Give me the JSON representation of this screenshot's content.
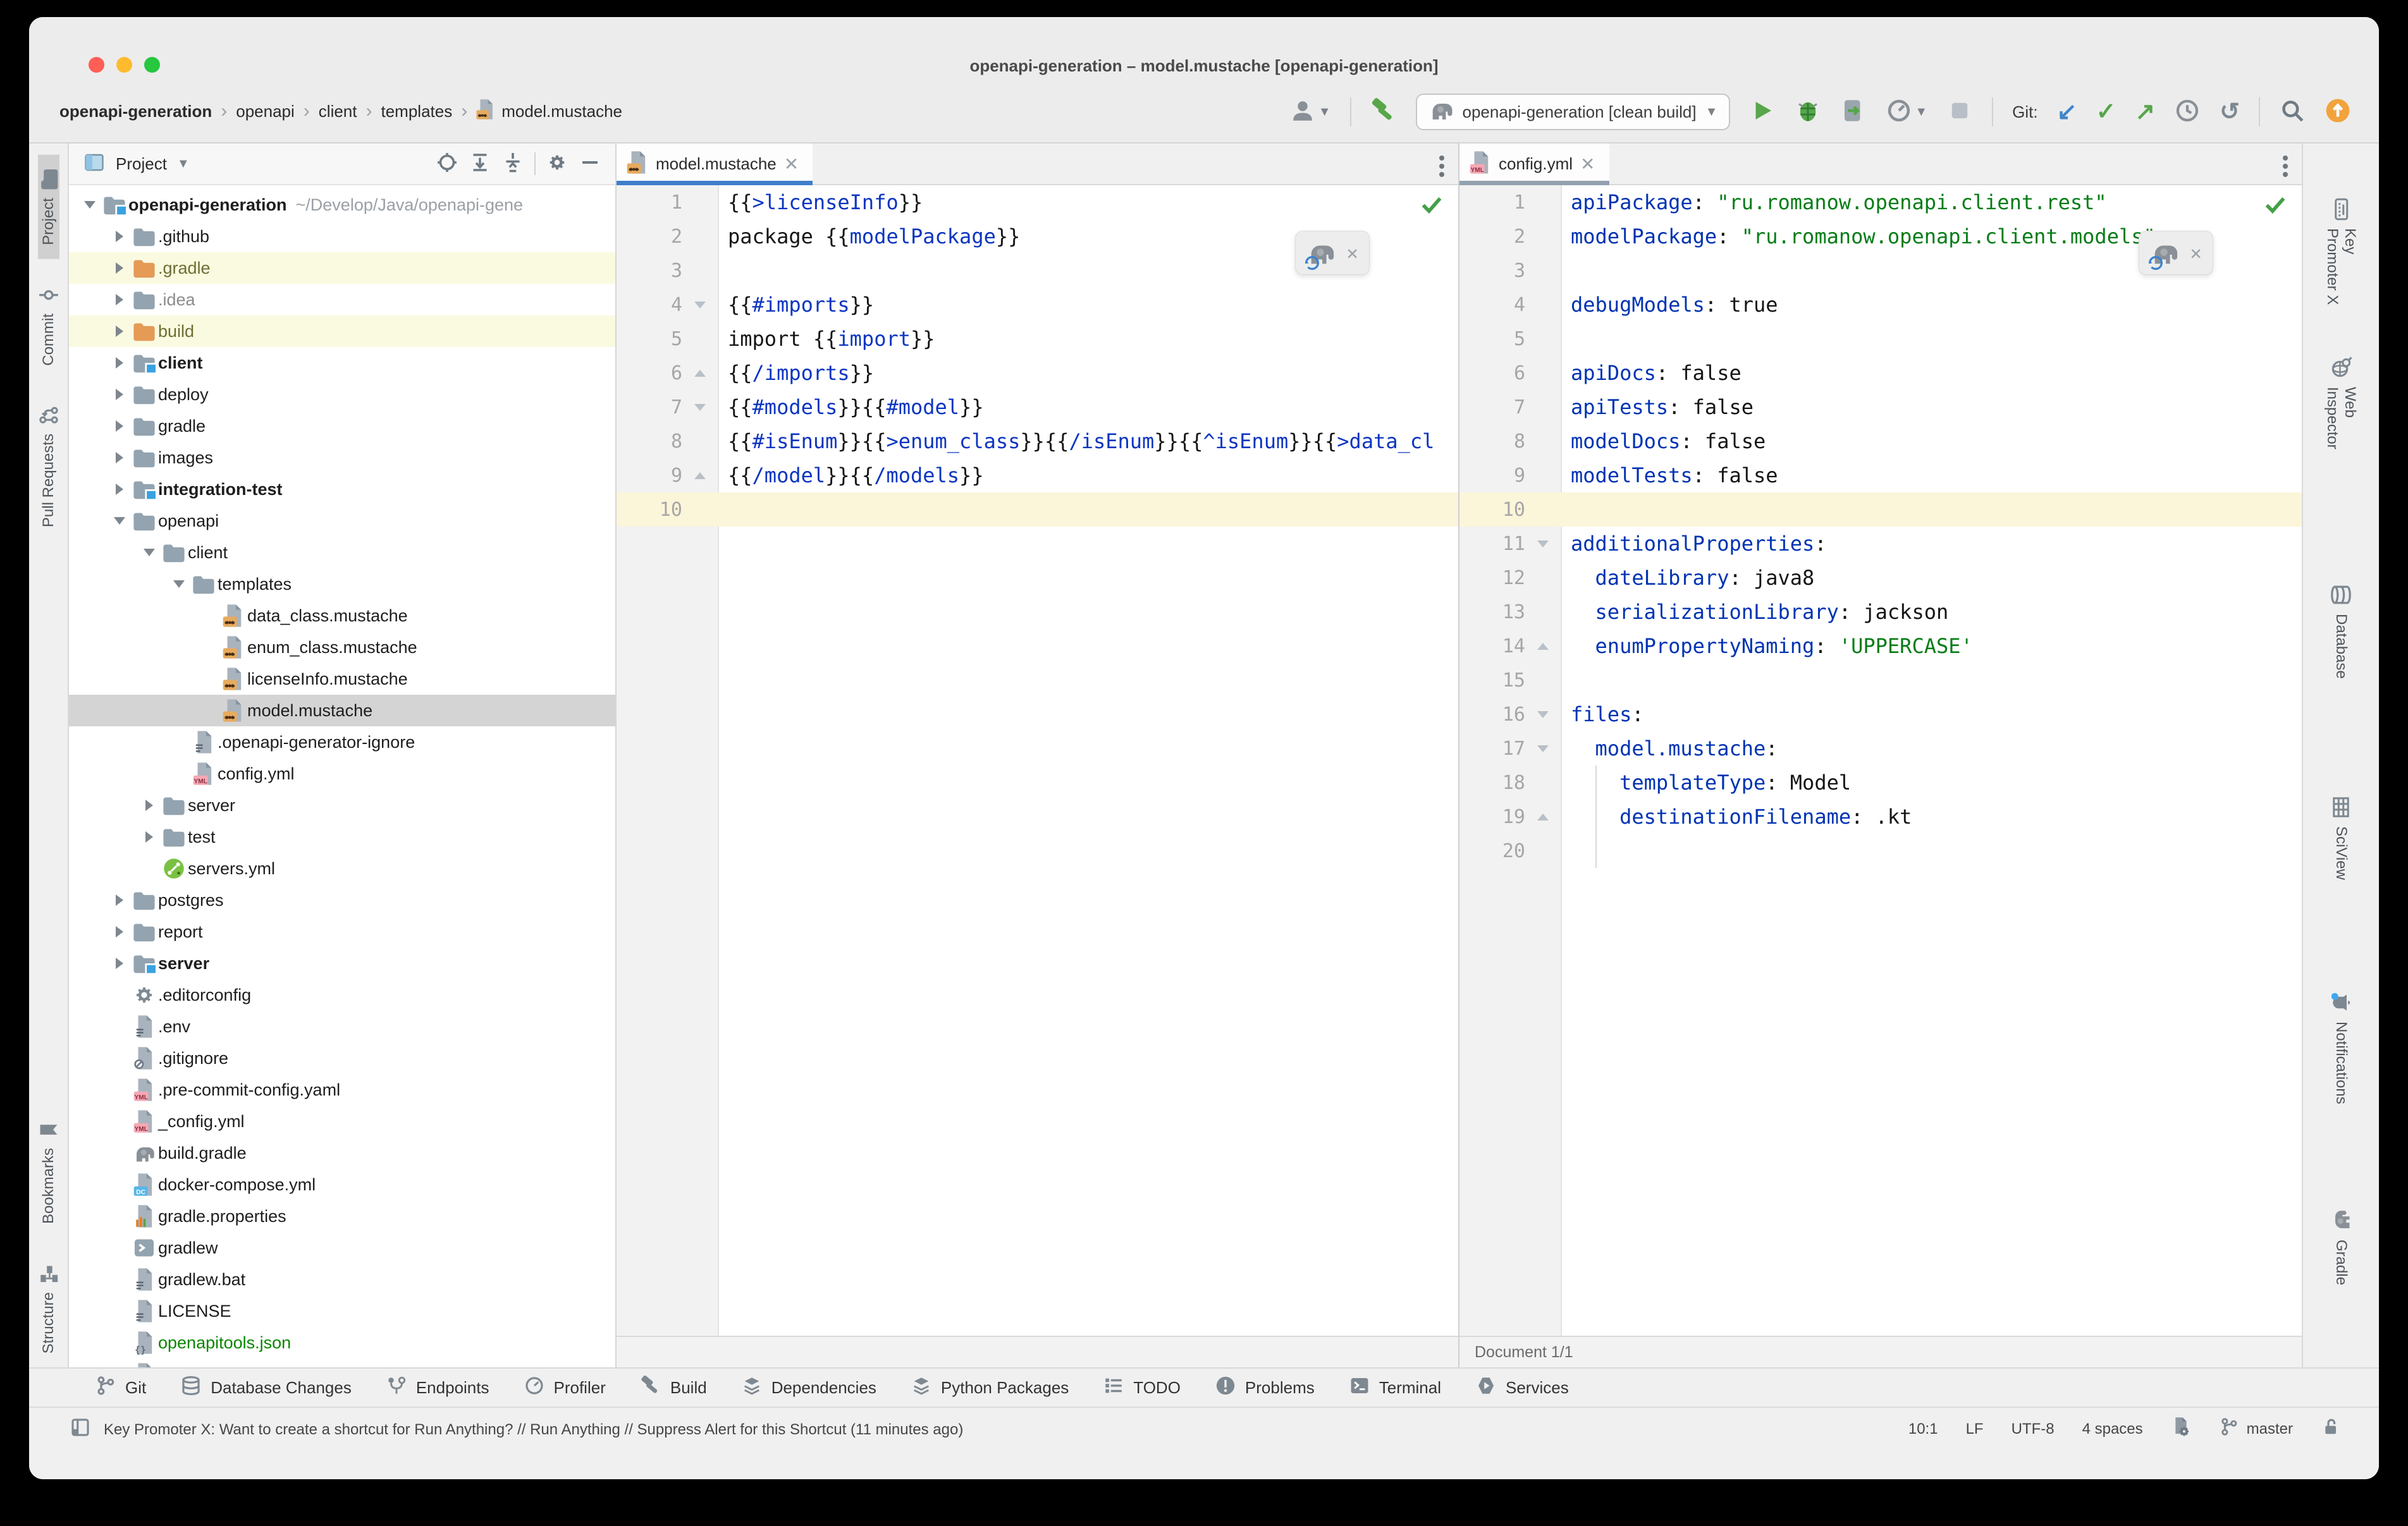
{
  "window": {
    "title": "openapi-generation – model.mustache [openapi-generation]"
  },
  "colors": {
    "accent_blue": "#3f7ecc",
    "inactive_tab_underline": "#93a1b0",
    "green": "#57a64a",
    "orange": "#f2a33c",
    "excluded_row": "#fafae1",
    "selected_row": "#d4d4d4",
    "caret_row": "#fbf5da"
  },
  "breadcrumb": {
    "items": [
      "openapi-generation",
      "openapi",
      "client",
      "templates"
    ],
    "file": "model.mustache"
  },
  "toolbar": {
    "run_config": "openapi-generation [clean build]",
    "git_label": "Git:",
    "actions": [
      {
        "name": "user-avatar-button",
        "icon": "user",
        "dropdown": true
      },
      {
        "sep": true
      },
      {
        "name": "build-project-button",
        "icon": "hammer"
      },
      {
        "combo": true
      },
      {
        "name": "run-button",
        "icon": "play"
      },
      {
        "name": "debug-button",
        "icon": "bug"
      },
      {
        "name": "run-with-coverage-button",
        "icon": "coverage"
      },
      {
        "name": "profiler-button",
        "icon": "profiler",
        "dropdown": true
      },
      {
        "name": "stop-button",
        "icon": "stop"
      },
      {
        "sep": true
      },
      {
        "gitlabel": true
      },
      {
        "name": "git-update-button",
        "icon": "arrow-down-left"
      },
      {
        "name": "git-commit-button",
        "icon": "check-green"
      },
      {
        "name": "git-push-button",
        "icon": "arrow-up-right"
      },
      {
        "name": "local-history-button",
        "icon": "clock"
      },
      {
        "name": "rollback-button",
        "icon": "rollback"
      },
      {
        "sep": true
      },
      {
        "name": "search-everywhere-button",
        "icon": "search"
      },
      {
        "name": "ide-update-button",
        "icon": "update-orange"
      }
    ]
  },
  "left_stripe": [
    {
      "label": "Project",
      "icon": "folder-tool-icon",
      "active": true,
      "bottom": false
    },
    {
      "label": "Commit",
      "icon": "commit-icon",
      "active": false,
      "bottom": false
    },
    {
      "label": "Pull Requests",
      "icon": "pull-request-icon",
      "active": false,
      "bottom": false
    },
    {
      "label": "Bookmarks",
      "icon": "bookmark-icon",
      "active": false,
      "bottom": true
    },
    {
      "label": "Structure",
      "icon": "structure-icon",
      "active": false,
      "bottom": true
    }
  ],
  "right_stripe": [
    {
      "label": "Key Promoter X",
      "icon": "keyboard-icon",
      "gap": 0
    },
    {
      "label": "Web Inspector",
      "icon": "web-inspector-icon",
      "gap": 120
    },
    {
      "label": "Database",
      "icon": "database-icon",
      "gap": 120
    },
    {
      "label": "SciView",
      "icon": "grid-icon",
      "gap": 110
    },
    {
      "label": "Notifications",
      "icon": "bell-icon",
      "gap": 100
    },
    {
      "label": "Gradle",
      "icon": "elephant-icon",
      "gap": 110
    }
  ],
  "project_panel": {
    "title": "Project",
    "root_path": "~/Develop/Java/openapi-gene",
    "tree": [
      {
        "d": 0,
        "label": "openapi-generation",
        "suffix": "~/Develop/Java/openapi-gene",
        "icon": "folder-module",
        "chev": "v",
        "bold": true,
        "cls": ""
      },
      {
        "d": 1,
        "label": ".github",
        "icon": "folder",
        "chev": ">",
        "cls": ""
      },
      {
        "d": 1,
        "label": ".gradle",
        "icon": "folder-excluded",
        "chev": ">",
        "row": "yellow",
        "cls": "olive"
      },
      {
        "d": 1,
        "label": ".idea",
        "icon": "folder",
        "chev": ">",
        "cls": "grey"
      },
      {
        "d": 1,
        "label": "build",
        "icon": "folder-excluded",
        "chev": ">",
        "row": "yellow",
        "cls": "olive"
      },
      {
        "d": 1,
        "label": "client",
        "icon": "folder-module",
        "chev": ">",
        "bold": true,
        "cls": ""
      },
      {
        "d": 1,
        "label": "deploy",
        "icon": "folder",
        "chev": ">",
        "cls": ""
      },
      {
        "d": 1,
        "label": "gradle",
        "icon": "folder",
        "chev": ">",
        "cls": ""
      },
      {
        "d": 1,
        "label": "images",
        "icon": "folder",
        "chev": ">",
        "cls": ""
      },
      {
        "d": 1,
        "label": "integration-test",
        "icon": "folder-module",
        "chev": ">",
        "bold": true,
        "cls": ""
      },
      {
        "d": 1,
        "label": "openapi",
        "icon": "folder",
        "chev": "v",
        "cls": ""
      },
      {
        "d": 2,
        "label": "client",
        "icon": "folder",
        "chev": "v",
        "cls": ""
      },
      {
        "d": 3,
        "label": "templates",
        "icon": "folder",
        "chev": "v",
        "cls": ""
      },
      {
        "d": 4,
        "label": "data_class.mustache",
        "icon": "mustache-file",
        "chev": "",
        "cls": ""
      },
      {
        "d": 4,
        "label": "enum_class.mustache",
        "icon": "mustache-file",
        "chev": "",
        "cls": ""
      },
      {
        "d": 4,
        "label": "licenseInfo.mustache",
        "icon": "mustache-file",
        "chev": "",
        "cls": ""
      },
      {
        "d": 4,
        "label": "model.mustache",
        "icon": "mustache-file",
        "chev": "",
        "sel": true,
        "cls": ""
      },
      {
        "d": 3,
        "label": ".openapi-generator-ignore",
        "icon": "text-file",
        "chev": "",
        "cls": ""
      },
      {
        "d": 3,
        "label": "config.yml",
        "icon": "yml-file",
        "chev": "",
        "cls": ""
      },
      {
        "d": 2,
        "label": "server",
        "icon": "folder",
        "chev": ">",
        "cls": ""
      },
      {
        "d": 2,
        "label": "test",
        "icon": "folder",
        "chev": ">",
        "cls": ""
      },
      {
        "d": 2,
        "label": "servers.yml",
        "icon": "openapi-file",
        "chev": "",
        "cls": ""
      },
      {
        "d": 1,
        "label": "postgres",
        "icon": "folder",
        "chev": ">",
        "cls": ""
      },
      {
        "d": 1,
        "label": "report",
        "icon": "folder",
        "chev": ">",
        "cls": ""
      },
      {
        "d": 1,
        "label": "server",
        "icon": "folder-module",
        "chev": ">",
        "bold": true,
        "cls": ""
      },
      {
        "d": 1,
        "label": ".editorconfig",
        "icon": "gear-file",
        "chev": "",
        "cls": ""
      },
      {
        "d": 1,
        "label": ".env",
        "icon": "text-file",
        "chev": "",
        "cls": ""
      },
      {
        "d": 1,
        "label": ".gitignore",
        "icon": "ignored-file",
        "chev": "",
        "cls": ""
      },
      {
        "d": 1,
        "label": ".pre-commit-config.yaml",
        "icon": "yml-file",
        "chev": "",
        "cls": ""
      },
      {
        "d": 1,
        "label": "_config.yml",
        "icon": "yml-file",
        "chev": "",
        "cls": ""
      },
      {
        "d": 1,
        "label": "build.gradle",
        "icon": "elephant-icon",
        "chev": "",
        "cls": ""
      },
      {
        "d": 1,
        "label": "docker-compose.yml",
        "icon": "docker-file",
        "chev": "",
        "cls": ""
      },
      {
        "d": 1,
        "label": "gradle.properties",
        "icon": "properties-file",
        "chev": "",
        "cls": ""
      },
      {
        "d": 1,
        "label": "gradlew",
        "icon": "shell-file",
        "chev": "",
        "cls": ""
      },
      {
        "d": 1,
        "label": "gradlew.bat",
        "icon": "text-file",
        "chev": "",
        "cls": ""
      },
      {
        "d": 1,
        "label": "LICENSE",
        "icon": "text-file",
        "chev": "",
        "cls": ""
      },
      {
        "d": 1,
        "label": "openapitools.json",
        "icon": "json-file",
        "chev": "",
        "cls": "green"
      },
      {
        "d": 1,
        "label": "README.md",
        "icon": "md-file",
        "chev": "",
        "cls": "blue"
      }
    ]
  },
  "editors": [
    {
      "tab": "model.mustache",
      "icon": "mustache-file",
      "active": true,
      "doc_status": "",
      "lines": [
        {
          "n": 1,
          "fold": "",
          "caret": false,
          "tokens": [
            [
              "{{",
              "d"
            ],
            [
              ">licenseInfo",
              "t"
            ],
            [
              "}}",
              "d"
            ]
          ]
        },
        {
          "n": 2,
          "fold": "",
          "caret": false,
          "tokens": [
            [
              "package ",
              "d"
            ],
            [
              "{{",
              "d"
            ],
            [
              "modelPackage",
              "t"
            ],
            [
              "}}",
              "d"
            ]
          ]
        },
        {
          "n": 3,
          "fold": "",
          "caret": false,
          "tokens": []
        },
        {
          "n": 4,
          "fold": "open",
          "caret": false,
          "tokens": [
            [
              "{{",
              "d"
            ],
            [
              "#imports",
              "t"
            ],
            [
              "}}",
              "d"
            ]
          ]
        },
        {
          "n": 5,
          "fold": "",
          "caret": false,
          "tokens": [
            [
              "import ",
              "d"
            ],
            [
              "{{",
              "d"
            ],
            [
              "import",
              "t"
            ],
            [
              "}}",
              "d"
            ]
          ]
        },
        {
          "n": 6,
          "fold": "close",
          "caret": false,
          "tokens": [
            [
              "{{",
              "d"
            ],
            [
              "/imports",
              "t"
            ],
            [
              "}}",
              "d"
            ]
          ]
        },
        {
          "n": 7,
          "fold": "open",
          "caret": false,
          "tokens": [
            [
              "{{",
              "d"
            ],
            [
              "#models",
              "t"
            ],
            [
              "}}",
              "d"
            ],
            [
              "{{",
              "d"
            ],
            [
              "#model",
              "t"
            ],
            [
              "}}",
              "d"
            ]
          ]
        },
        {
          "n": 8,
          "fold": "",
          "caret": false,
          "tokens": [
            [
              "{{",
              "d"
            ],
            [
              "#isEnum",
              "t"
            ],
            [
              "}}",
              "d"
            ],
            [
              "{{",
              "d"
            ],
            [
              ">enum_class",
              "t"
            ],
            [
              "}}",
              "d"
            ],
            [
              "{{",
              "d"
            ],
            [
              "/isEnum",
              "t"
            ],
            [
              "}}",
              "d"
            ],
            [
              "{{",
              "d"
            ],
            [
              "^isEnum",
              "t"
            ],
            [
              "}}",
              "d"
            ],
            [
              "{{",
              "d"
            ],
            [
              ">data_cl",
              "t"
            ]
          ]
        },
        {
          "n": 9,
          "fold": "close",
          "caret": false,
          "tokens": [
            [
              "{{",
              "d"
            ],
            [
              "/model",
              "t"
            ],
            [
              "}}",
              "d"
            ],
            [
              "{{",
              "d"
            ],
            [
              "/models",
              "t"
            ],
            [
              "}}",
              "d"
            ]
          ]
        },
        {
          "n": 10,
          "fold": "",
          "caret": true,
          "tokens": []
        }
      ]
    },
    {
      "tab": "config.yml",
      "icon": "yml-file",
      "active": false,
      "doc_status": "Document 1/1",
      "lines": [
        {
          "n": 1,
          "fold": "",
          "caret": false,
          "tokens": [
            [
              "apiPackage",
              "k"
            ],
            [
              ": ",
              "d"
            ],
            [
              "\"ru.romanow.openapi.client.rest\"",
              "s"
            ]
          ]
        },
        {
          "n": 2,
          "fold": "",
          "caret": false,
          "tokens": [
            [
              "modelPackage",
              "k"
            ],
            [
              ": ",
              "d"
            ],
            [
              "\"ru.romanow.openapi.client.models\"",
              "s"
            ]
          ]
        },
        {
          "n": 3,
          "fold": "",
          "caret": false,
          "tokens": []
        },
        {
          "n": 4,
          "fold": "",
          "caret": false,
          "tokens": [
            [
              "debugModels",
              "k"
            ],
            [
              ": ",
              "d"
            ],
            [
              "true",
              "d"
            ]
          ]
        },
        {
          "n": 5,
          "fold": "",
          "caret": false,
          "tokens": []
        },
        {
          "n": 6,
          "fold": "",
          "caret": false,
          "tokens": [
            [
              "apiDocs",
              "k"
            ],
            [
              ": ",
              "d"
            ],
            [
              "false",
              "d"
            ]
          ]
        },
        {
          "n": 7,
          "fold": "",
          "caret": false,
          "tokens": [
            [
              "apiTests",
              "k"
            ],
            [
              ": ",
              "d"
            ],
            [
              "false",
              "d"
            ]
          ]
        },
        {
          "n": 8,
          "fold": "",
          "caret": false,
          "tokens": [
            [
              "modelDocs",
              "k"
            ],
            [
              ": ",
              "d"
            ],
            [
              "false",
              "d"
            ]
          ]
        },
        {
          "n": 9,
          "fold": "",
          "caret": false,
          "tokens": [
            [
              "modelTests",
              "k"
            ],
            [
              ": ",
              "d"
            ],
            [
              "false",
              "d"
            ]
          ]
        },
        {
          "n": 10,
          "fold": "",
          "caret": true,
          "tokens": []
        },
        {
          "n": 11,
          "fold": "open",
          "caret": false,
          "tokens": [
            [
              "additionalProperties",
              "k"
            ],
            [
              ":",
              "d"
            ]
          ]
        },
        {
          "n": 12,
          "fold": "",
          "caret": false,
          "tokens": [
            [
              "  ",
              "d"
            ],
            [
              "dateLibrary",
              "k"
            ],
            [
              ": ",
              "d"
            ],
            [
              "java8",
              "d"
            ]
          ]
        },
        {
          "n": 13,
          "fold": "",
          "caret": false,
          "tokens": [
            [
              "  ",
              "d"
            ],
            [
              "serializationLibrary",
              "k"
            ],
            [
              ": ",
              "d"
            ],
            [
              "jackson",
              "d"
            ]
          ]
        },
        {
          "n": 14,
          "fold": "close",
          "caret": false,
          "tokens": [
            [
              "  ",
              "d"
            ],
            [
              "enumPropertyNaming",
              "k"
            ],
            [
              ": ",
              "d"
            ],
            [
              "'UPPERCASE'",
              "s"
            ]
          ]
        },
        {
          "n": 15,
          "fold": "",
          "caret": false,
          "tokens": []
        },
        {
          "n": 16,
          "fold": "open",
          "caret": false,
          "tokens": [
            [
              "files",
              "k"
            ],
            [
              ":",
              "d"
            ]
          ]
        },
        {
          "n": 17,
          "fold": "open",
          "caret": false,
          "tokens": [
            [
              "  ",
              "d"
            ],
            [
              "model.mustache",
              "k"
            ],
            [
              ":",
              "d"
            ]
          ]
        },
        {
          "n": 18,
          "fold": "",
          "caret": false,
          "tokens": [
            [
              "    ",
              "d"
            ],
            [
              "templateType",
              "k"
            ],
            [
              ": ",
              "d"
            ],
            [
              "Model",
              "d"
            ]
          ]
        },
        {
          "n": 19,
          "fold": "close",
          "caret": false,
          "tokens": [
            [
              "    ",
              "d"
            ],
            [
              "destinationFilename",
              "k"
            ],
            [
              ": ",
              "d"
            ],
            [
              ".kt",
              "d"
            ]
          ]
        },
        {
          "n": 20,
          "fold": "",
          "caret": false,
          "tokens": []
        }
      ]
    }
  ],
  "bottom_bar": [
    {
      "label": "Git",
      "icon": "branch-icon"
    },
    {
      "label": "Database Changes",
      "icon": "database-icon"
    },
    {
      "label": "Endpoints",
      "icon": "endpoints-icon"
    },
    {
      "label": "Profiler",
      "icon": "profiler-small-icon"
    },
    {
      "label": "Build",
      "icon": "hammer-grey-icon"
    },
    {
      "label": "Dependencies",
      "icon": "layers-icon"
    },
    {
      "label": "Python Packages",
      "icon": "layers-icon"
    },
    {
      "label": "TODO",
      "icon": "todo-icon"
    },
    {
      "label": "Problems",
      "icon": "problem-icon"
    },
    {
      "label": "Terminal",
      "icon": "terminal-icon"
    },
    {
      "label": "Services",
      "icon": "services-icon"
    }
  ],
  "status_bar": {
    "message": "Key Promoter X: Want to create a shortcut for Run Anything? // Run Anything // Suppress Alert for this Shortcut (11 minutes ago)",
    "caret_position": "10:1",
    "line_separator": "LF",
    "encoding": "UTF-8",
    "indent": "4 spaces",
    "branch": "master"
  }
}
